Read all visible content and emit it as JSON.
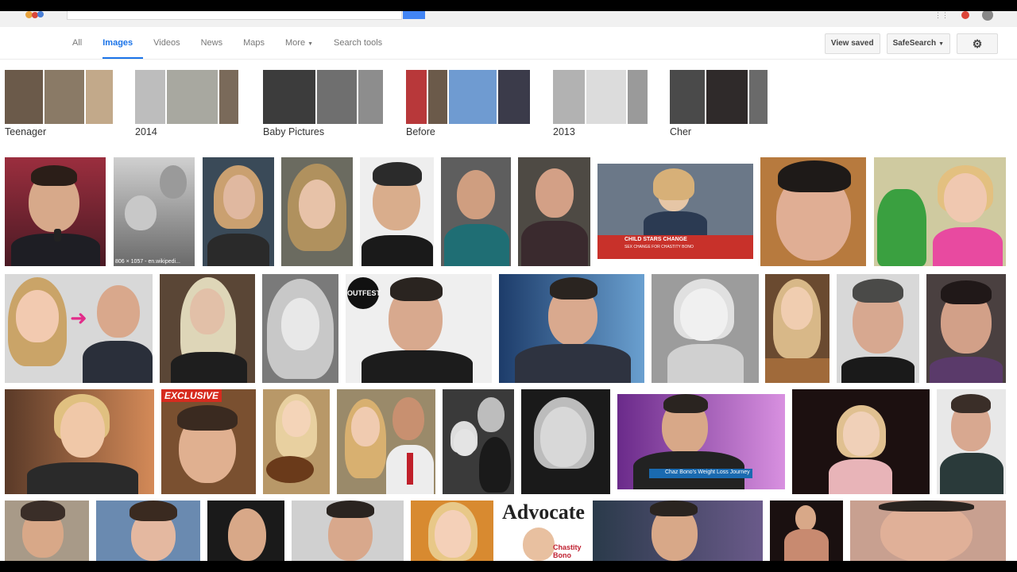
{
  "nav": {
    "tabs": [
      {
        "label": "All",
        "active": false
      },
      {
        "label": "Images",
        "active": true
      },
      {
        "label": "Videos",
        "active": false
      },
      {
        "label": "News",
        "active": false
      },
      {
        "label": "Maps",
        "active": false
      },
      {
        "label": "More",
        "active": false
      },
      {
        "label": "Search tools",
        "active": false
      }
    ],
    "view_saved": "View saved",
    "safesearch": "SafeSearch",
    "settings_icon": "gear-icon"
  },
  "related": [
    {
      "label": "Teenager"
    },
    {
      "label": "2014"
    },
    {
      "label": "Baby Pictures"
    },
    {
      "label": "Before"
    },
    {
      "label": "2013"
    },
    {
      "label": "Cher"
    }
  ],
  "overlays": {
    "source_caption": "806 × 1057 - en.wikipedi...",
    "news_headline": "CHILD STARS CHANGE",
    "news_sub": "SEX CHANGE FOR CHASTITY BONO",
    "outfest": "OUTFEST",
    "exclusive": "EXCLUSIVE",
    "weight_caption": "Chaz Bono's Weight Loss Journey",
    "magazine_title": "Advocate",
    "magazine_name": "Chastity Bono"
  },
  "colors": {
    "accent": "#1a73e8",
    "search_button": "#4285f4",
    "exclusive_red": "#d62b1e"
  }
}
